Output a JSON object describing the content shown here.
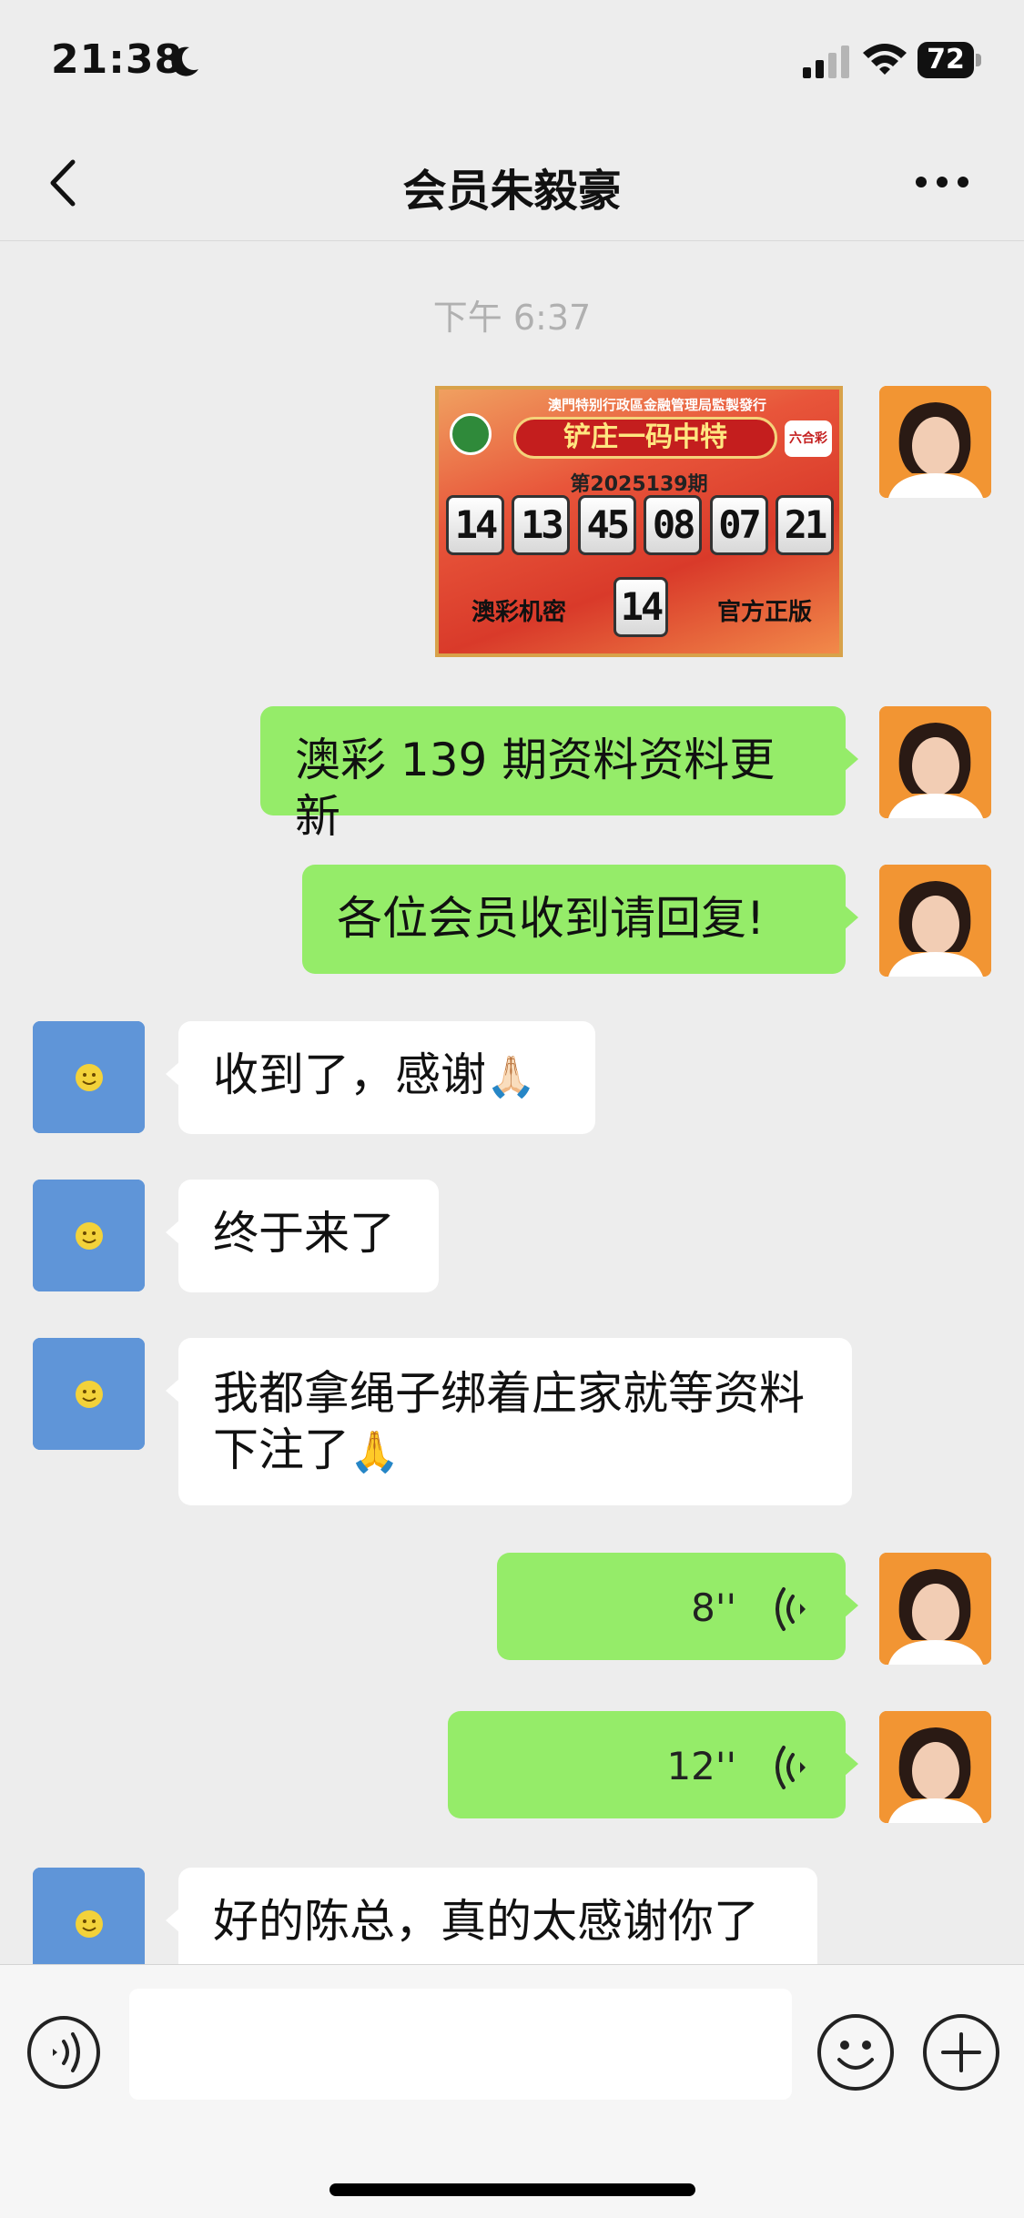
{
  "status_bar": {
    "time": "21:38",
    "moon_icon": "moon-icon",
    "signal_icon": "cellular-signal-icon",
    "wifi_icon": "wifi-icon",
    "battery_level": "72"
  },
  "nav": {
    "back_icon": "chevron-left-icon",
    "title": "会员朱毅豪",
    "more_icon": "more-dots-icon"
  },
  "timestamp": "下午 6:37",
  "image_card": {
    "header": "澳門特别行政區金融管理局監製發行",
    "title": "铲庄一码中特",
    "logo_right": "六合彩",
    "period": "第2025139期",
    "numbers": [
      "14",
      "13",
      "45",
      "08",
      "07",
      "21"
    ],
    "special": "14",
    "left_caption": "澳彩机密",
    "right_caption": "官方正版"
  },
  "messages": [
    {
      "side": "me",
      "type": "text",
      "text": "澳彩 139 期资料资料更新"
    },
    {
      "side": "me",
      "type": "text",
      "text": "各位会员收到请回复!"
    },
    {
      "side": "them",
      "type": "text",
      "text": "收到了，感谢",
      "emoji": "🙏🏻"
    },
    {
      "side": "them",
      "type": "text",
      "text": "终于来了"
    },
    {
      "side": "them",
      "type": "text",
      "line1": "我都拿绳子绑着庄家就等资料",
      "line2": "下注了",
      "emoji": "🙏"
    },
    {
      "side": "me",
      "type": "voice",
      "duration": "8''"
    },
    {
      "side": "me",
      "type": "voice",
      "duration": "12''"
    },
    {
      "side": "them",
      "type": "text",
      "text": "好的陈总，真的太感谢你了"
    }
  ],
  "input_bar": {
    "voice_icon": "voice-input-icon",
    "emoji_icon": "emoji-icon",
    "plus_icon": "plus-circle-icon"
  }
}
